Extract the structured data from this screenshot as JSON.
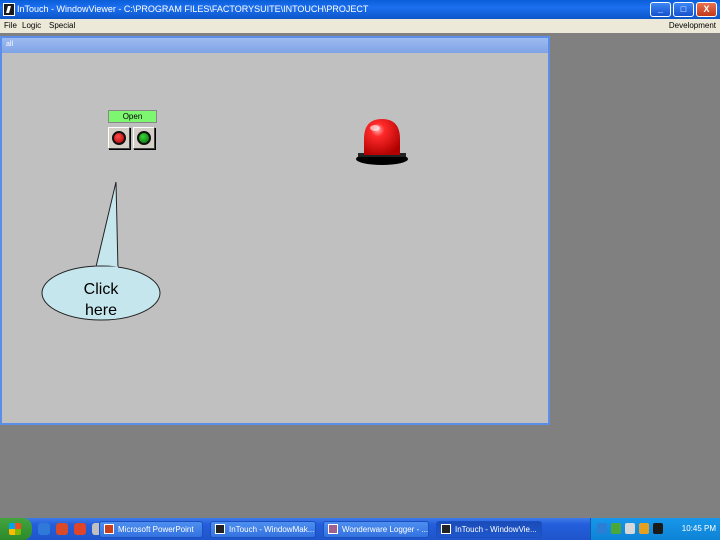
{
  "window": {
    "title": "InTouch - WindowViewer - C:\\PROGRAM FILES\\FACTORYSUITE\\INTOUCH\\PROJECT",
    "controls": [
      "_",
      "□",
      "X"
    ]
  },
  "menu": {
    "items": [
      "File",
      "Logic",
      "Special"
    ],
    "right": "Development"
  },
  "inner_window": {
    "caption": "all"
  },
  "canvas": {
    "status_label": "Open",
    "status_color": "#7cf76f",
    "buttons": [
      {
        "name": "stop-button",
        "color": "#c00000"
      },
      {
        "name": "start-button",
        "color": "#058a05"
      }
    ],
    "beacon": {
      "state": "on",
      "color": "#ff0000"
    },
    "callout": {
      "line1": "Click",
      "line2": "here",
      "fill": "#c6e6ee"
    }
  },
  "taskbar": {
    "items": [
      {
        "label": "Microsoft PowerPoint"
      },
      {
        "label": "InTouch - WindowMak..."
      },
      {
        "label": "Wonderware Logger - ..."
      },
      {
        "label": "InTouch - WindowVie...",
        "active": true
      }
    ],
    "tray_time": "10:45 PM"
  }
}
